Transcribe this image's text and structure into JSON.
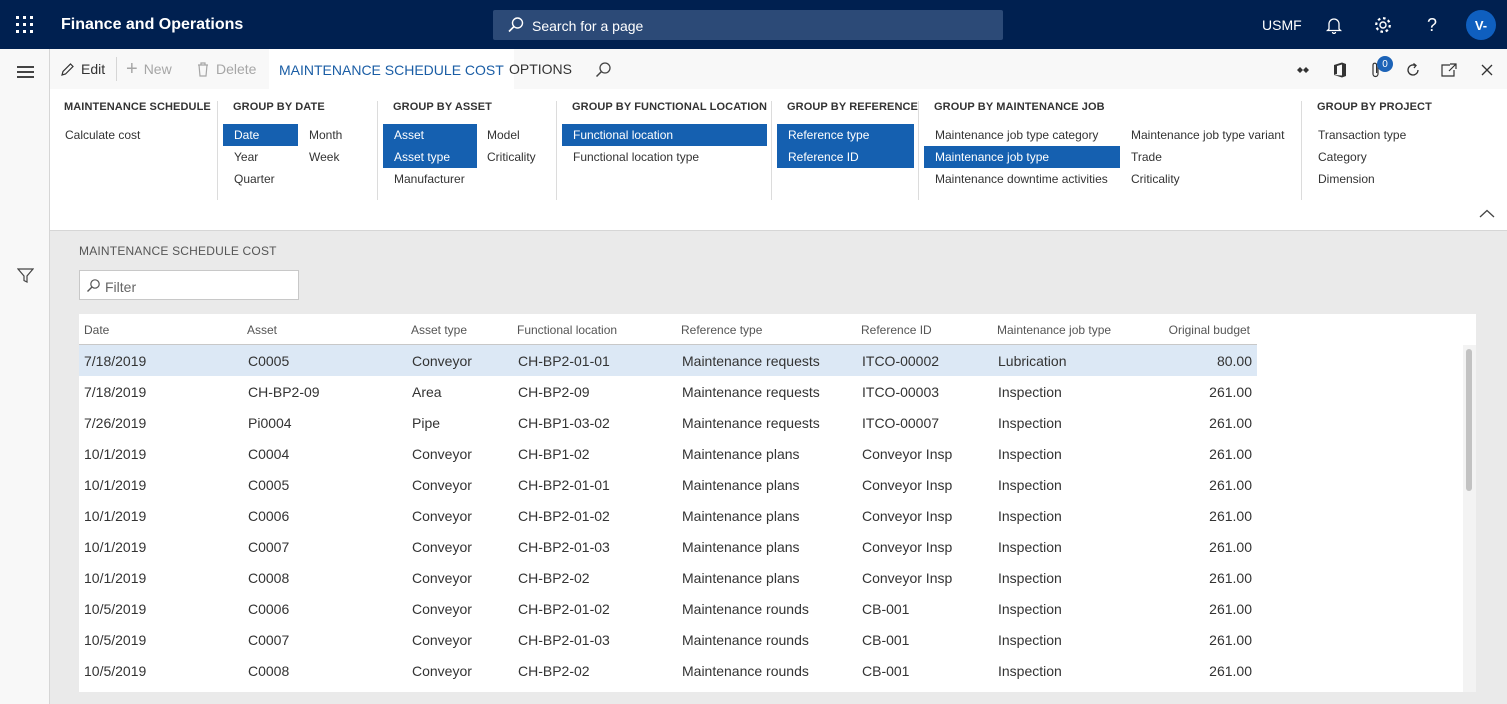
{
  "topbar": {
    "app_title": "Finance and Operations",
    "search_placeholder": "Search for a page",
    "company": "USMF",
    "avatar_initials": "V-",
    "icons": [
      "waffle-icon",
      "search-icon",
      "bell-icon",
      "gear-icon",
      "help-icon"
    ]
  },
  "actionbar": {
    "edit": "Edit",
    "new": "New",
    "delete": "Delete",
    "tab_active": "MAINTENANCE SCHEDULE COST",
    "tab_options": "OPTIONS",
    "attachments_count": "0"
  },
  "ribbon": {
    "schedule": {
      "title": "MAINTENANCE SCHEDULE",
      "calculate": "Calculate cost"
    },
    "date": {
      "title": "GROUP BY DATE",
      "date": "Date",
      "year": "Year",
      "quarter": "Quarter",
      "month": "Month",
      "week": "Week"
    },
    "asset": {
      "title": "GROUP BY ASSET",
      "asset": "Asset",
      "asset_type": "Asset type",
      "manufacturer": "Manufacturer",
      "model": "Model",
      "criticality": "Criticality"
    },
    "functional": {
      "title": "GROUP BY FUNCTIONAL LOCATION",
      "location": "Functional location",
      "location_type": "Functional location type"
    },
    "reference": {
      "title": "GROUP BY REFERENCE",
      "ref_type": "Reference type",
      "ref_id": "Reference ID"
    },
    "job": {
      "title": "GROUP BY MAINTENANCE JOB",
      "category": "Maintenance job type category",
      "job_type": "Maintenance job type",
      "downtime": "Maintenance downtime activities",
      "variant": "Maintenance job type variant",
      "trade": "Trade",
      "criticality": "Criticality"
    },
    "project": {
      "title": "GROUP BY PROJECT",
      "transaction_type": "Transaction type",
      "category": "Category",
      "dimension": "Dimension"
    }
  },
  "content": {
    "section_title": "MAINTENANCE SCHEDULE COST",
    "filter_placeholder": "Filter"
  },
  "grid": {
    "columns": [
      "Date",
      "Asset",
      "Asset type",
      "Functional location",
      "Reference type",
      "Reference ID",
      "Maintenance job type",
      "Original budget"
    ],
    "rows": [
      [
        "7/18/2019",
        "C0005",
        "Conveyor",
        "CH-BP2-01-01",
        "Maintenance requests",
        "ITCO-00002",
        "Lubrication",
        "80.00"
      ],
      [
        "7/18/2019",
        "CH-BP2-09",
        "Area",
        "CH-BP2-09",
        "Maintenance requests",
        "ITCO-00003",
        "Inspection",
        "261.00"
      ],
      [
        "7/26/2019",
        "Pi0004",
        "Pipe",
        "CH-BP1-03-02",
        "Maintenance requests",
        "ITCO-00007",
        "Inspection",
        "261.00"
      ],
      [
        "10/1/2019",
        "C0004",
        "Conveyor",
        "CH-BP1-02",
        "Maintenance plans",
        "Conveyor Insp",
        "Inspection",
        "261.00"
      ],
      [
        "10/1/2019",
        "C0005",
        "Conveyor",
        "CH-BP2-01-01",
        "Maintenance plans",
        "Conveyor Insp",
        "Inspection",
        "261.00"
      ],
      [
        "10/1/2019",
        "C0006",
        "Conveyor",
        "CH-BP2-01-02",
        "Maintenance plans",
        "Conveyor Insp",
        "Inspection",
        "261.00"
      ],
      [
        "10/1/2019",
        "C0007",
        "Conveyor",
        "CH-BP2-01-03",
        "Maintenance plans",
        "Conveyor Insp",
        "Inspection",
        "261.00"
      ],
      [
        "10/1/2019",
        "C0008",
        "Conveyor",
        "CH-BP2-02",
        "Maintenance plans",
        "Conveyor Insp",
        "Inspection",
        "261.00"
      ],
      [
        "10/5/2019",
        "C0006",
        "Conveyor",
        "CH-BP2-01-02",
        "Maintenance rounds",
        "CB-001",
        "Inspection",
        "261.00"
      ],
      [
        "10/5/2019",
        "C0007",
        "Conveyor",
        "CH-BP2-01-03",
        "Maintenance rounds",
        "CB-001",
        "Inspection",
        "261.00"
      ],
      [
        "10/5/2019",
        "C0008",
        "Conveyor",
        "CH-BP2-02",
        "Maintenance rounds",
        "CB-001",
        "Inspection",
        "261.00"
      ]
    ]
  }
}
